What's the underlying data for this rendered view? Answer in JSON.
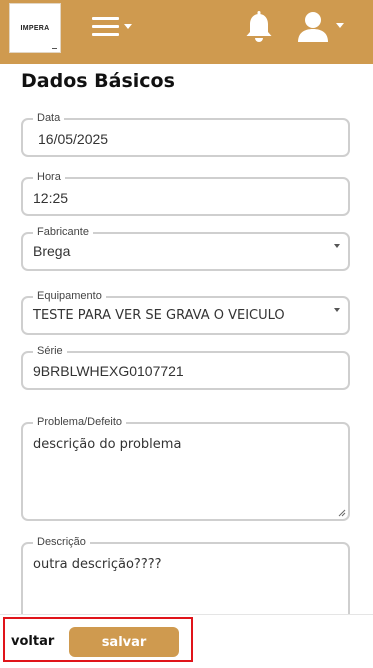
{
  "colors": {
    "brand": "#cf9a4f",
    "highlight_border": "#e0141a"
  },
  "header": {
    "logo_text": "IMPERA",
    "icons": [
      "hamburger-menu-icon",
      "bell-icon",
      "user-icon"
    ]
  },
  "form": {
    "title": "Dados Básicos",
    "fields": {
      "data": {
        "label": "Data",
        "value": "16/05/2025"
      },
      "hora": {
        "label": "Hora",
        "value": "12:25"
      },
      "fabricante": {
        "label": "Fabricante",
        "value": "Brega"
      },
      "equipamento": {
        "label": "Equipamento",
        "value": "TESTE PARA VER SE GRAVA O VEICULO"
      },
      "serie": {
        "label": "Série",
        "value": "9BRBLWHEXG0107721"
      },
      "problema": {
        "label": "Problema/Defeito",
        "value": "descrição do problema"
      },
      "descricao": {
        "label": "Descrição",
        "value": "outra descrição????"
      }
    }
  },
  "footer": {
    "back_label": "voltar",
    "save_label": "salvar"
  }
}
